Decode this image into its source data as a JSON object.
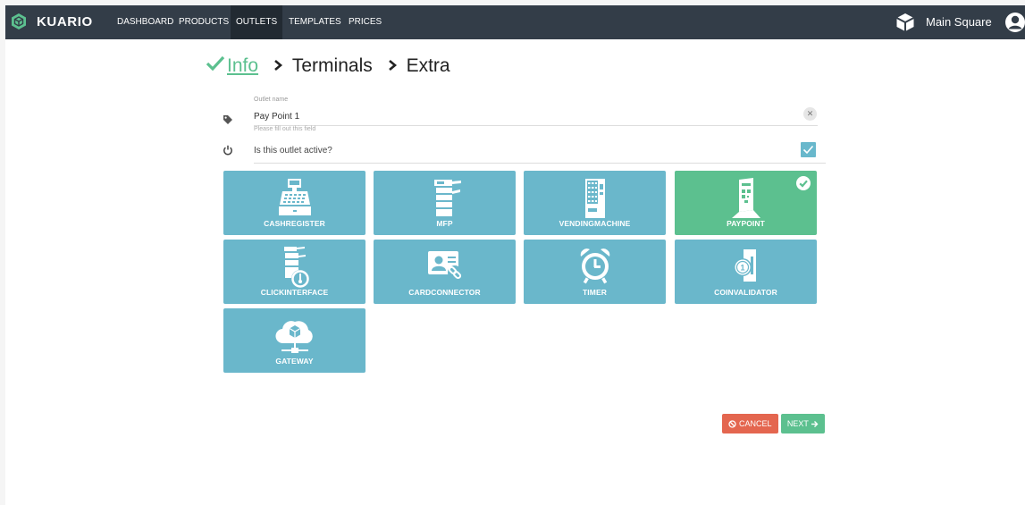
{
  "brand": {
    "name": "KUARIO",
    "icon": "kuario-cube-icon"
  },
  "nav": {
    "items": [
      {
        "label": "DASHBOARD",
        "active": false
      },
      {
        "label": "PRODUCTS",
        "active": false
      },
      {
        "label": "OUTLETS",
        "active": true
      },
      {
        "label": "TEMPLATES",
        "active": false
      },
      {
        "label": "PRICES",
        "active": false
      }
    ],
    "store_name": "Main Square",
    "store_icon": "cube-icon",
    "user_icon": "user-icon"
  },
  "wizard": {
    "steps": [
      {
        "label": "Info",
        "state": "done"
      },
      {
        "label": "Terminals",
        "state": "todo"
      },
      {
        "label": "Extra",
        "state": "todo"
      }
    ]
  },
  "form": {
    "outlet_name_label": "Outlet name",
    "outlet_name_value": "Pay Point 1",
    "hint": "Please fill out this field",
    "active_label": "Is this outlet active?",
    "active_checked": true
  },
  "terminals": [
    {
      "label": "CASHREGISTER",
      "icon": "cash-register-icon",
      "selected": false
    },
    {
      "label": "MFP",
      "icon": "printer-icon",
      "selected": false
    },
    {
      "label": "VENDINGMACHINE",
      "icon": "vending-machine-icon",
      "selected": false
    },
    {
      "label": "PAYPOINT",
      "icon": "paypoint-icon",
      "selected": true
    },
    {
      "label": "CLICKINTERFACE",
      "icon": "click-interface-icon",
      "selected": false
    },
    {
      "label": "CARDCONNECTOR",
      "icon": "card-connector-icon",
      "selected": false
    },
    {
      "label": "TIMER",
      "icon": "alarm-clock-icon",
      "selected": false
    },
    {
      "label": "COINVALIDATOR",
      "icon": "coin-validator-icon",
      "selected": false
    },
    {
      "label": "GATEWAY",
      "icon": "cloud-gateway-icon",
      "selected": false
    }
  ],
  "buttons": {
    "cancel": "CANCEL",
    "next": "NEXT"
  },
  "colors": {
    "navbar": "#333d48",
    "tile": "#6ab7cb",
    "selected": "#5cc08f",
    "cancel": "#e4664f",
    "next": "#5cc08f"
  }
}
